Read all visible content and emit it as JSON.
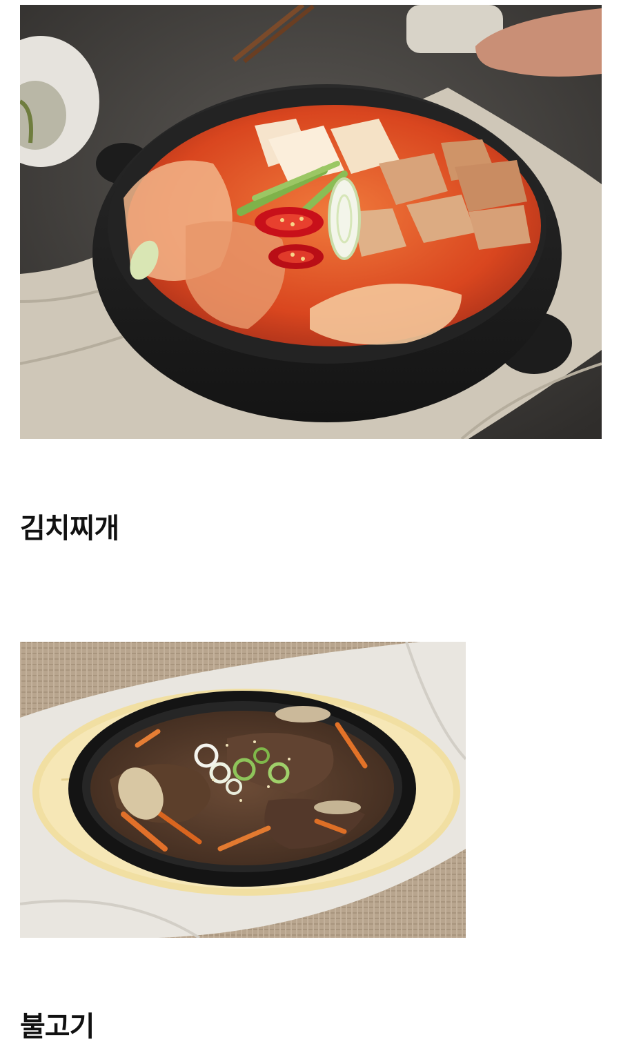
{
  "dishes": [
    {
      "title": "김치찌개",
      "photo_icon": "kimchi-stew-photo"
    },
    {
      "title": "불고기",
      "photo_icon": "bulgogi-photo"
    }
  ],
  "colors": {
    "text": "#111111",
    "background": "#ffffff",
    "stew_broth": "#e0542a",
    "stone_pot": "#1e1e1e",
    "sizzling_plate": "#1a1a1a",
    "wood_board": "#f1dfa2",
    "beef": "#5a3e2c"
  }
}
